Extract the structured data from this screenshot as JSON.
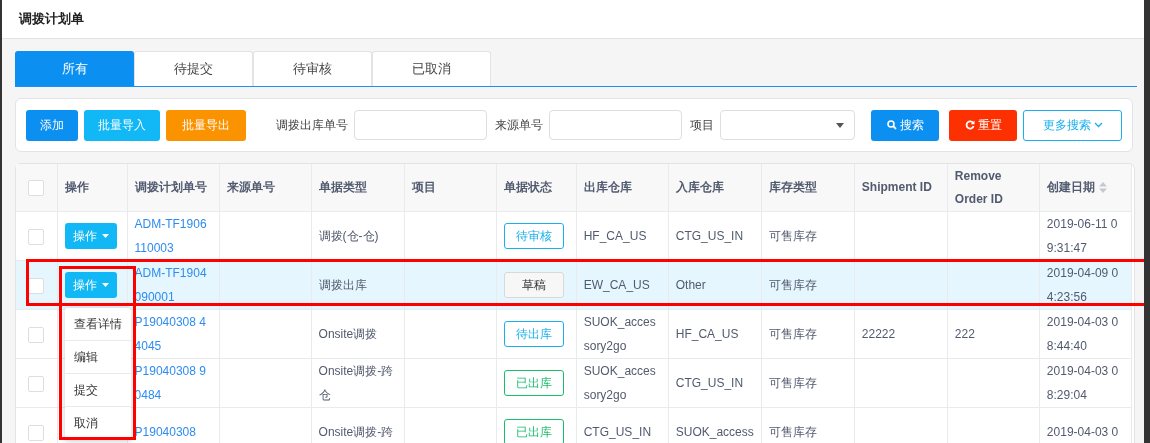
{
  "page_title": "调拨计划单",
  "tabs": [
    {
      "label": "所有",
      "selected": true
    },
    {
      "label": "待提交",
      "selected": false
    },
    {
      "label": "待审核",
      "selected": false
    },
    {
      "label": "已取消",
      "selected": false
    }
  ],
  "toolbar": {
    "buttons": [
      {
        "label": "添加",
        "kind": "primary"
      },
      {
        "label": "批量导入",
        "kind": "info"
      },
      {
        "label": "批量导出",
        "kind": "warning"
      }
    ],
    "filters": [
      {
        "label": "调拨出库单号",
        "kind": "text"
      },
      {
        "label": "来源单号",
        "kind": "text"
      },
      {
        "label": "项目",
        "kind": "select"
      }
    ],
    "search_button": "搜索",
    "reset_button": "重置",
    "more_search_button": "更多搜索"
  },
  "table": {
    "all_checked": false,
    "columns": [
      "操作",
      "调拨计划单号",
      "来源单号",
      "单据类型",
      "项目",
      "单据状态",
      "出库仓库",
      "入库仓库",
      "库存类型",
      "Shipment ID",
      "Remove Order ID",
      "创建日期"
    ],
    "rows": [
      {
        "checked": false,
        "selected": false,
        "action": "操作",
        "order_no": "ADM-TF1906110003",
        "type": "调拨(仓-仓)",
        "status": {
          "text": "待审核",
          "color": "#1ab0f0"
        },
        "out_wh": "HF_CA_US",
        "in_wh": "CTG_US_IN",
        "stock_type": "可售库存",
        "created": "2019-06-11 09:31:47"
      },
      {
        "checked": false,
        "selected": true,
        "action": "操作",
        "order_no": "ADM-TF1904090001",
        "type": "调拨出库",
        "status": {
          "text": "草稿",
          "color": "#d9d9d9"
        },
        "out_wh": "EW_CA_US",
        "in_wh": "Other",
        "stock_type": "可售库存",
        "created": "2019-04-09 04:23:56"
      },
      {
        "checked": false,
        "selected": false,
        "order_no": "P19040308 44045",
        "type": "Onsite调拨",
        "status": {
          "text": "待出库",
          "color": "#1ab0f0"
        },
        "out_wh": "SUOK_accessory2go",
        "in_wh": "HF_CA_US",
        "stock_type": "可售库存",
        "shipment_id": "22222",
        "remove_id": "222",
        "created": "2019-04-03 08:44:40"
      },
      {
        "checked": false,
        "selected": false,
        "order_no": "P19040308 90484",
        "type": "Onsite调拨-跨仓",
        "status": {
          "text": "已出库",
          "color": "#19be6b"
        },
        "out_wh": "SUOK_accessory2go",
        "in_wh": "CTG_US_IN",
        "stock_type": "可售库存",
        "created": "2019-04-03 08:29:04"
      },
      {
        "checked": false,
        "selected": false,
        "order_no": "P19040308",
        "type": "Onsite调拨-跨",
        "status": {
          "text": "已出库",
          "color": "#19be6b"
        },
        "out_wh": "CTG_US_IN",
        "in_wh": "SUOK_access",
        "stock_type": "可售库存",
        "created": "2019-04-03 0"
      }
    ]
  },
  "row_menu": {
    "items": [
      "查看详情",
      "编辑",
      "提交",
      "取消"
    ]
  },
  "annotations": {
    "row_frame": true,
    "menu_frame": true
  }
}
